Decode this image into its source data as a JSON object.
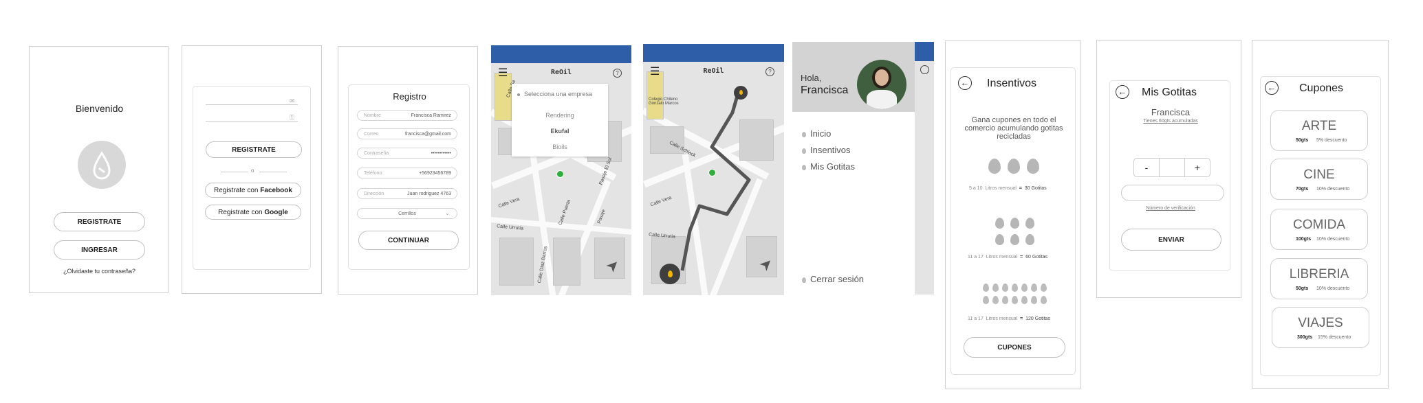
{
  "welcome": {
    "title": "Bienvenido",
    "register": "REGISTRATE",
    "login": "INGRESAR",
    "forgot": "¿Olvidaste tu contraseña?"
  },
  "signup": {
    "register": "REGISTRATE",
    "divider": "o",
    "facebook_prefix": "Registrate con ",
    "facebook_brand": "Facebook",
    "google_prefix": "Registrate con ",
    "google_brand": "Google"
  },
  "registro": {
    "title": "Registro",
    "fields": [
      {
        "label": "Nombre",
        "value": "Francisca Ramirez"
      },
      {
        "label": "Correo",
        "value": "francisca@gmail.com"
      },
      {
        "label": "Contraseña",
        "value": "••••••••••••"
      },
      {
        "label": "Teléfono",
        "value": "+56923456789"
      },
      {
        "label": "Dirección",
        "value": "Juan rodriguez 4763"
      }
    ],
    "select_value": "Cerrillos",
    "continue": "CONTINUAR"
  },
  "map1": {
    "app_title": "ReOil",
    "help": "?",
    "dropdown_placeholder": "Selecciona una empresa",
    "options": [
      "Rendering",
      "Ekufal",
      "Bioils"
    ],
    "streets": [
      "Calle Sa",
      "Calle Schlack",
      "Calle Vera",
      "Calle Urrutia",
      "Calle Puerta",
      "Calle Diaz Barros",
      "Pasaje",
      "Pasaje El Sol"
    ]
  },
  "map2": {
    "app_title": "ReOil",
    "help": "?",
    "poi": "Colegio Chileno Gonzalo Marcos"
  },
  "menu": {
    "greeting": "Hola,",
    "name": "Francisca",
    "items": [
      "Inicio",
      "Insentivos",
      "Mis Gotitas"
    ],
    "logout": "Cerrar sesión"
  },
  "insentivos": {
    "title": "Insentivos",
    "description": "Gana cupones en todo el comercio acumulando gotitas recicladas",
    "tiers": [
      {
        "range": "5 a 10",
        "unit": "Litros mensual",
        "eq": "=",
        "reward": "30 Gotitas"
      },
      {
        "range": "11 a 17",
        "unit": "Litros mensual",
        "eq": "=",
        "reward": "60 Gotitas"
      },
      {
        "range": "11 a 17",
        "unit": "Litros mensual",
        "eq": "=",
        "reward": "120 Gotitas"
      }
    ],
    "button": "CUPONES"
  },
  "gotitas": {
    "title": "Mis Gotitas",
    "name": "Francisca",
    "accumulated": "Tienes 60gts acumuladas",
    "minus": "-",
    "plus": "+",
    "verification": "Número de verificación",
    "send": "ENVIAR"
  },
  "cupones": {
    "title": "Cupones",
    "items": [
      {
        "name": "ARTE",
        "gts": "50gts",
        "desc": "5% descuento"
      },
      {
        "name": "CINE",
        "gts": "70gts",
        "desc": "10% descuento"
      },
      {
        "name": "COMIDA",
        "gts": "100gts",
        "desc": "10% descuento"
      },
      {
        "name": "LIBRERIA",
        "gts": "50gts",
        "desc": "10% descuento"
      },
      {
        "name": "VIAJES",
        "gts": "300gts",
        "desc": "15% descuento"
      }
    ]
  },
  "colors": {
    "accent_blue": "#2e5ea7",
    "route": "#555555",
    "pin": "#3f3f3f",
    "pin_fill": "#f2b600",
    "location": "#2fae3a"
  },
  "icons": [
    "droplet-logo-icon",
    "mail-icon",
    "key-icon",
    "hamburger-icon",
    "help-icon",
    "navigation-arrow-icon",
    "location-pin-icon",
    "back-arrow-icon",
    "droplet-icon",
    "chevron-down-icon",
    "user-photo"
  ]
}
